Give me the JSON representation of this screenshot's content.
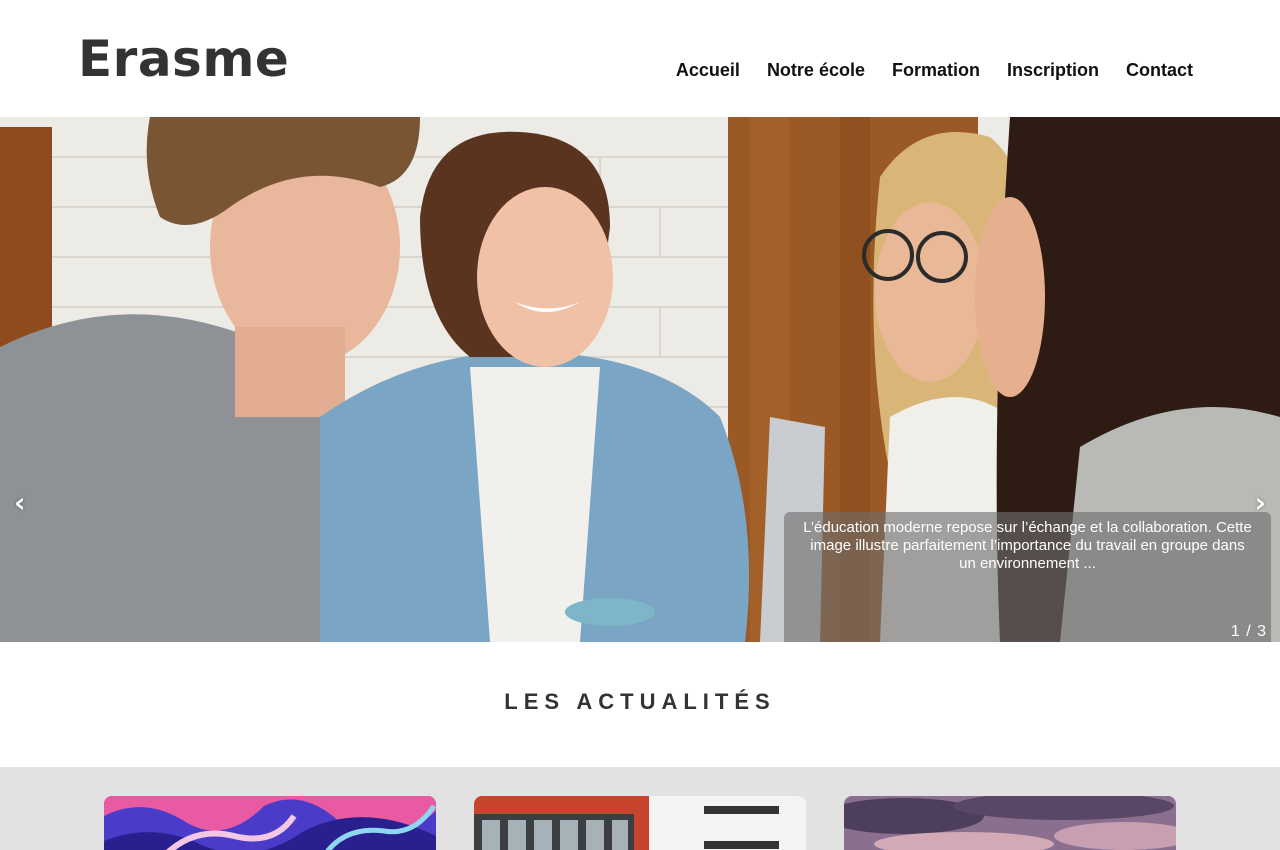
{
  "header": {
    "logo": "Erasme",
    "nav": [
      "Accueil",
      "Notre école",
      "Formation",
      "Inscription",
      "Contact"
    ]
  },
  "hero": {
    "prev_icon": "‹",
    "next_icon": "›",
    "caption": "L’éducation moderne repose sur l’échange et la collaboration. Cette image illustre parfaitement l’importance du travail en groupe dans un environnement ...",
    "counter": "1 / 3",
    "current_slide": 1,
    "total_slides": 3
  },
  "news": {
    "title": "LES ACTUALITÉS",
    "cards": [
      {
        "icon": "abstract-fluid-image"
      },
      {
        "icon": "building-image"
      },
      {
        "icon": "sky-image"
      }
    ]
  },
  "colors": {
    "text": "#333333",
    "band": "#e2e2e2",
    "caption_bg": "#6e6e6e"
  }
}
